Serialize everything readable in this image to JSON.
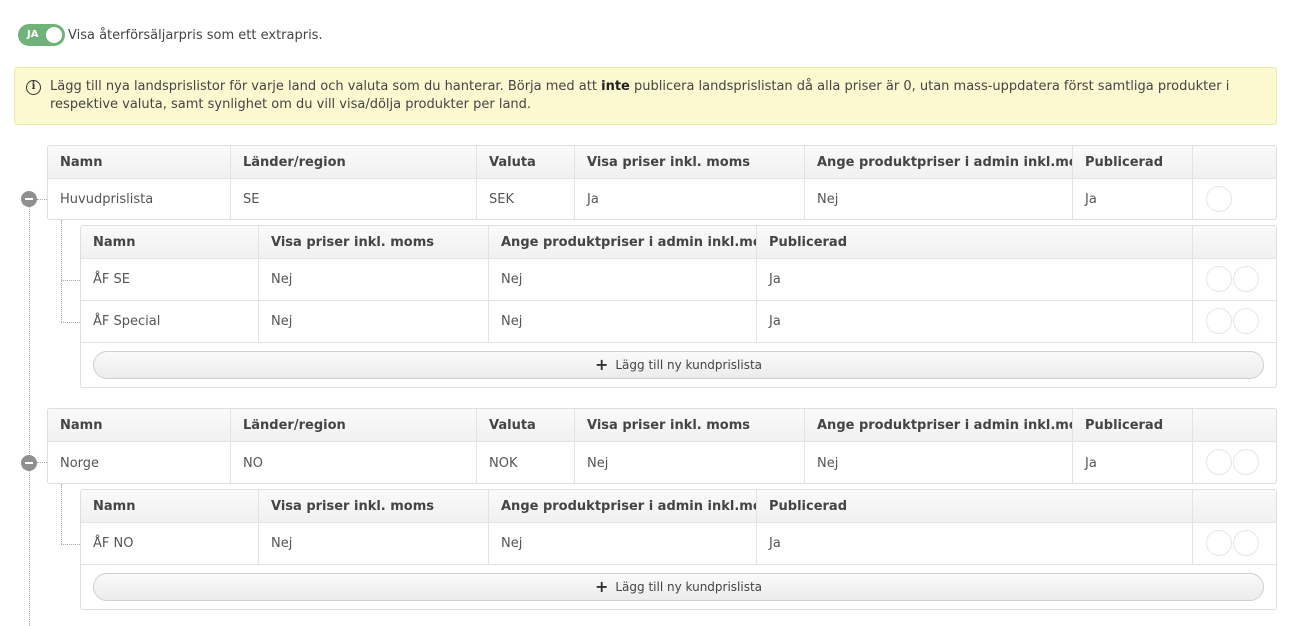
{
  "toggle": {
    "label": "JA",
    "text": "Visa återförsäljarpris som ett extrapris."
  },
  "info": {
    "before": "Lägg till nya landsprislistor för varje land och valuta som du hanterar. Börja med att ",
    "bold": "inte",
    "after": " publicera landsprislistan då alla priser är 0, utan mass-uppdatera först samtliga produkter i respektive valuta, samt synlighet om du vill visa/dölja produkter per land."
  },
  "country_headers": [
    "Namn",
    "Länder/region",
    "Valuta",
    "Visa priser inkl. moms",
    "Ange produktpriser i admin inkl.moms",
    "Publicerad"
  ],
  "customer_headers": [
    "Namn",
    "Visa priser inkl. moms",
    "Ange produktpriser i admin inkl.moms",
    "Publicerad"
  ],
  "add_customer_label": "Lägg till ny kundprislista",
  "countries": [
    {
      "cells": [
        "Huvudprislista",
        "SE",
        "SEK",
        "Ja",
        "Nej",
        "Ja"
      ],
      "customers": [
        [
          "ÅF SE",
          "Nej",
          "Nej",
          "Ja"
        ],
        [
          "ÅF Special",
          "Nej",
          "Nej",
          "Ja"
        ]
      ]
    },
    {
      "cells": [
        "Norge",
        "NO",
        "NOK",
        "Nej",
        "Nej",
        "Ja"
      ],
      "customers": [
        [
          "ÅF NO",
          "Nej",
          "Nej",
          "Ja"
        ]
      ]
    }
  ]
}
